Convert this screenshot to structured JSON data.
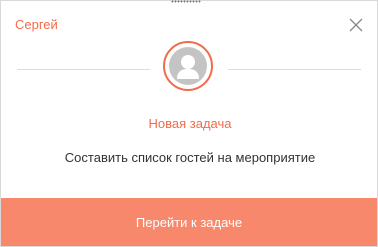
{
  "notification": {
    "sender_name": "Сергей",
    "task_type": "Новая задача",
    "task_text": "Составить список гостей на мероприятие",
    "action_label": "Перейти к задаче"
  },
  "icons": {
    "close": "close-icon",
    "avatar": "user-icon"
  },
  "colors": {
    "accent": "#f26b4d",
    "button_background": "#f8886b",
    "avatar_placeholder": "#c4c4c4",
    "body_text": "#333333"
  }
}
